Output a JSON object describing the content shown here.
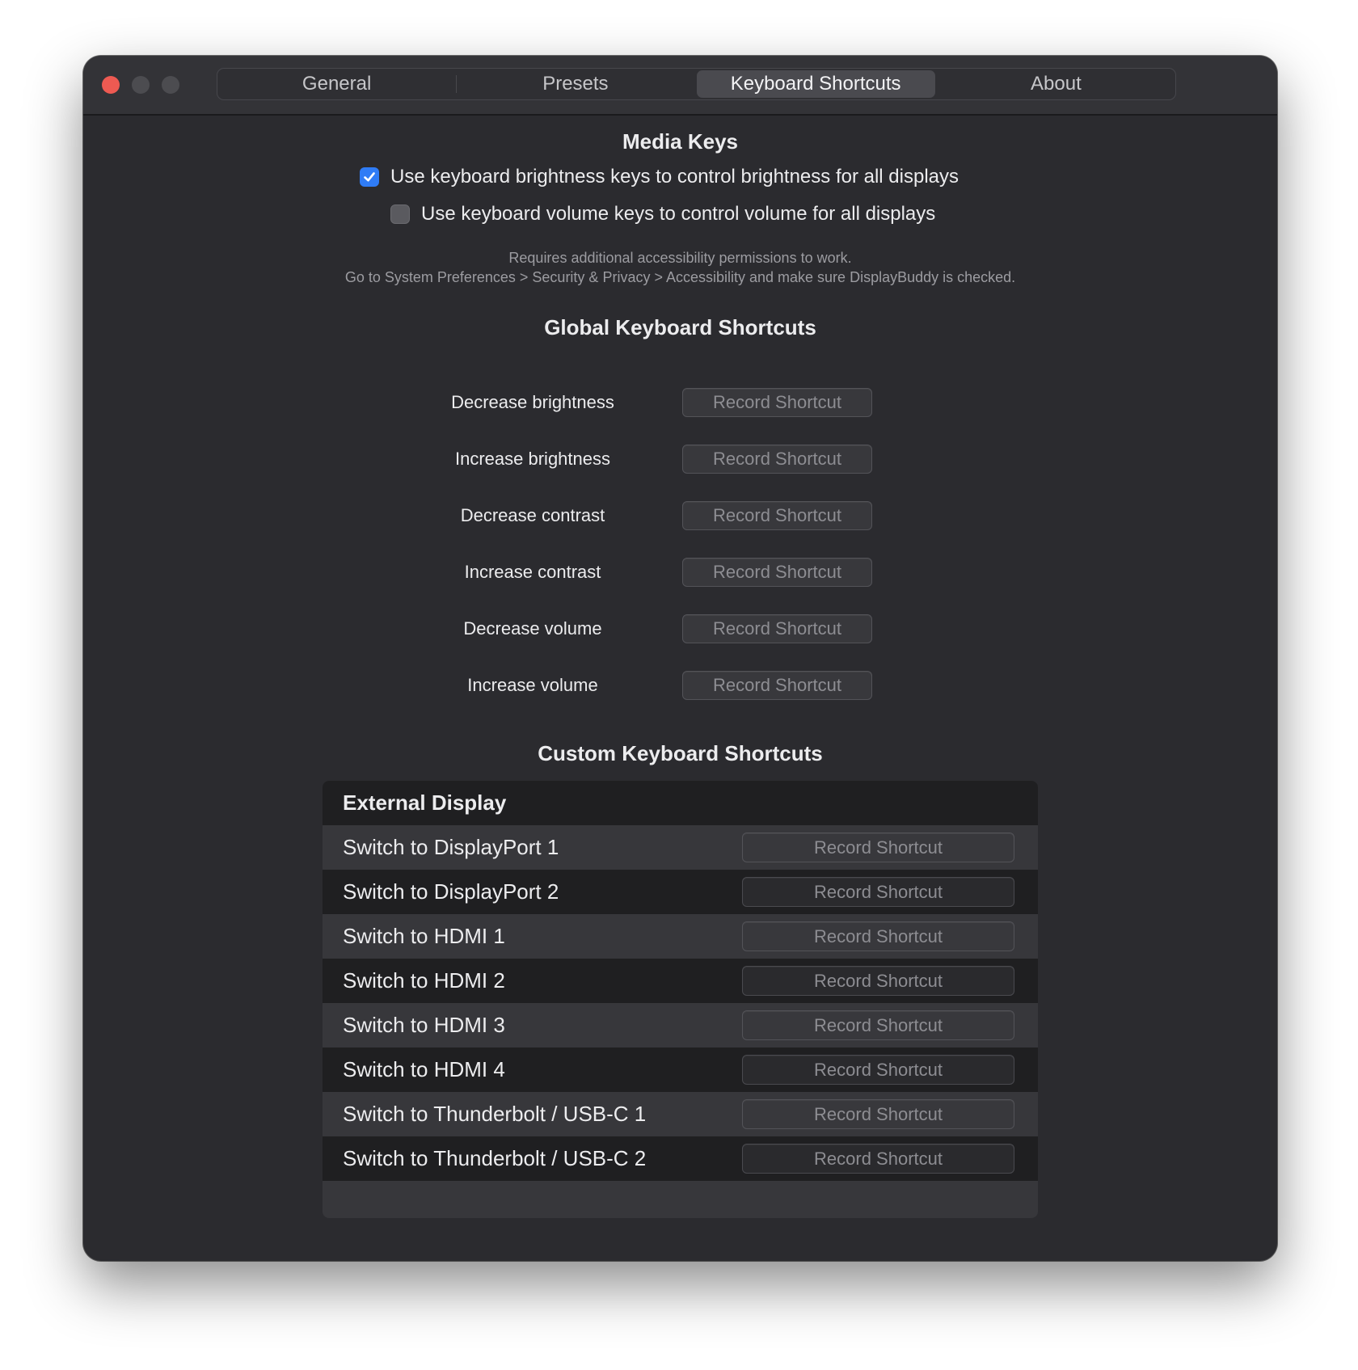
{
  "tabs": [
    "General",
    "Presets",
    "Keyboard Shortcuts",
    "About"
  ],
  "active_tab": "Keyboard Shortcuts",
  "media_keys": {
    "title": "Media Keys",
    "brightness_option": {
      "label": "Use keyboard brightness keys to control brightness for all displays",
      "checked": true
    },
    "volume_option": {
      "label": "Use keyboard volume keys to control volume for all displays",
      "checked": false
    },
    "note_line1": "Requires additional accessibility permissions to work.",
    "note_line2": "Go to System Preferences > Security & Privacy > Accessibility and make sure DisplayBuddy is checked."
  },
  "global": {
    "title": "Global Keyboard Shortcuts",
    "items": [
      {
        "label": "Decrease brightness",
        "button": "Record Shortcut"
      },
      {
        "label": "Increase brightness",
        "button": "Record Shortcut"
      },
      {
        "label": "Decrease contrast",
        "button": "Record Shortcut"
      },
      {
        "label": "Increase contrast",
        "button": "Record Shortcut"
      },
      {
        "label": "Decrease volume",
        "button": "Record Shortcut"
      },
      {
        "label": "Increase volume",
        "button": "Record Shortcut"
      }
    ]
  },
  "custom": {
    "title": "Custom Keyboard Shortcuts",
    "group": "External Display",
    "items": [
      {
        "label": "Switch to DisplayPort 1",
        "button": "Record Shortcut"
      },
      {
        "label": "Switch to DisplayPort 2",
        "button": "Record Shortcut"
      },
      {
        "label": "Switch to HDMI 1",
        "button": "Record Shortcut"
      },
      {
        "label": "Switch to HDMI 2",
        "button": "Record Shortcut"
      },
      {
        "label": "Switch to HDMI 3",
        "button": "Record Shortcut"
      },
      {
        "label": "Switch to HDMI 4",
        "button": "Record Shortcut"
      },
      {
        "label": "Switch to Thunderbolt / USB-C 1",
        "button": "Record Shortcut"
      },
      {
        "label": "Switch to Thunderbolt / USB-C 2",
        "button": "Record Shortcut"
      }
    ]
  },
  "colors": {
    "accent": "#2f7cf6",
    "close_button": "#ee5a52",
    "window_background": "#2b2b2f"
  }
}
